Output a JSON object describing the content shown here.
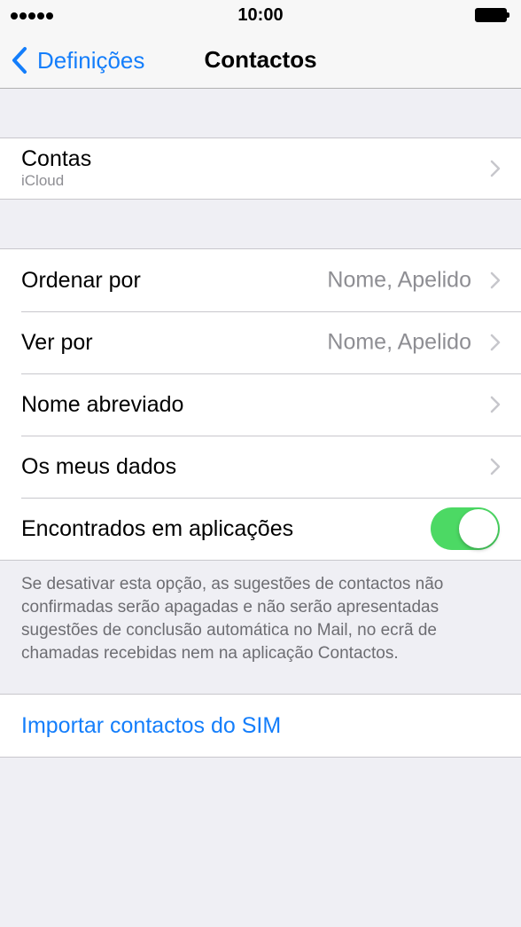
{
  "status_bar": {
    "time": "10:00",
    "signal_icon": "signal-dots-icon",
    "battery_icon": "battery-full-icon"
  },
  "nav": {
    "back_label": "Definições",
    "title": "Contactos"
  },
  "accounts": {
    "label": "Contas",
    "subtitle": "iCloud"
  },
  "settings": {
    "sort_order": {
      "label": "Ordenar por",
      "value": "Nome, Apelido"
    },
    "display_order": {
      "label": "Ver por",
      "value": "Nome, Apelido"
    },
    "short_name": {
      "label": "Nome abreviado"
    },
    "my_info": {
      "label": "Os meus dados"
    },
    "found_in_apps": {
      "label": "Encontrados em aplicações",
      "enabled": true
    }
  },
  "footer_note": "Se desativar esta opção, as sugestões de contactos não confirmadas serão apagadas e não serão apresentadas sugestões de conclusão automática no Mail, no ecrã de chamadas recebidas nem na aplicação Contactos.",
  "import_sim": {
    "label": "Importar contactos do SIM"
  },
  "colors": {
    "accent": "#147efb",
    "toggle_on": "#4cd964",
    "background": "#efeff4",
    "secondary_text": "#8e8e93"
  }
}
